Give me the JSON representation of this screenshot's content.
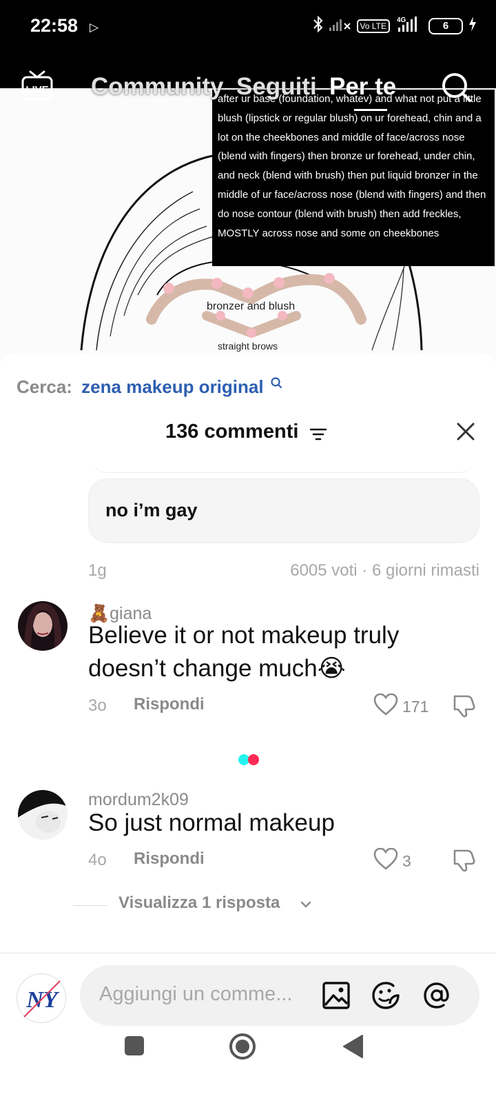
{
  "status_bar": {
    "time": "22:58",
    "icons": [
      "play-icon",
      "bluetooth-icon",
      "no-signal-icon",
      "volte-icon",
      "4g-signal-icon",
      "battery-icon",
      "charging-icon"
    ],
    "volte_label": "Vo LTE",
    "network_label": "4G",
    "battery_level": "6"
  },
  "top_nav": {
    "tabs": [
      {
        "label": "Community",
        "active": false
      },
      {
        "label": "Seguiti",
        "active": false
      },
      {
        "label": "Per te",
        "active": true
      }
    ],
    "live_label": "LIVE"
  },
  "video": {
    "overlay_text": "after ur base (foundation, whatev) and what not put a little blush (lipstick or regular blush) on ur forehead, chin and a lot on the cheekbones and middle of face/across nose (blend with fingers) then bronze ur forehead, under chin, and neck (blend with brush) then put liquid bronzer in the middle of ur face/across nose (blend with fingers) and then do nose contour (blend with brush) then add freckles, MOSTLY across nose and some on cheekbones",
    "heart_label": "bronzer and blush",
    "brows_label": "straight brows"
  },
  "sheet": {
    "search_prefix": "Cerca:",
    "search_term": "zena makeup original",
    "comment_count": "136 commenti",
    "poll": {
      "text": "no i’m gay",
      "time": "1g",
      "meta": "6005 voti · 6 giorni rimasti"
    },
    "comments": [
      {
        "user_emoji": "🧸",
        "user": "giana",
        "text": "Believe it or not makeup truly doesn’t change much😭",
        "time": "3o",
        "reply_label": "Rispondi",
        "likes": "171"
      },
      {
        "user": "mordum2k09",
        "text": "So just normal makeup",
        "time": "4o",
        "reply_label": "Rispondi",
        "likes": "3"
      }
    ],
    "view_replies": "Visualizza 1 risposta",
    "input_placeholder": "Aggiungi un comme..."
  },
  "colors": {
    "accent_link": "#2e5fb0",
    "muted_text": "#8a8a8a",
    "loader_cyan": "#25f4ee",
    "loader_red": "#fe2c55"
  }
}
